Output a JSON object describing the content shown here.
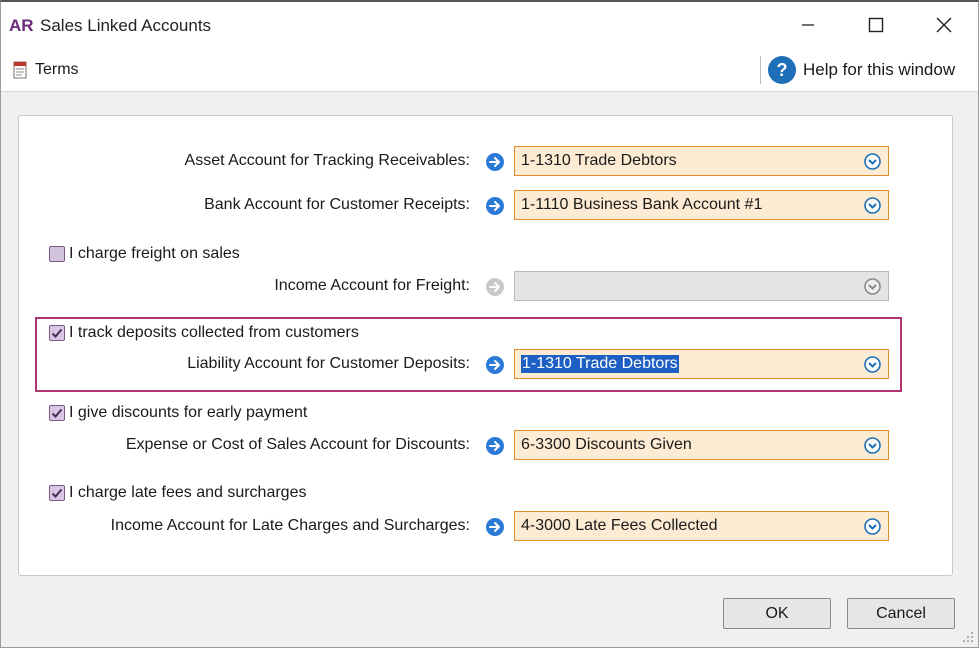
{
  "window": {
    "app_badge": "AR",
    "title": "Sales Linked Accounts"
  },
  "toolbar": {
    "terms_label": "Terms",
    "help_label": "Help for this window"
  },
  "rows": {
    "asset": {
      "label": "Asset Account for Tracking Receivables:",
      "value": "1-1310 Trade Debtors"
    },
    "bank": {
      "label": "Bank Account for Customer Receipts:",
      "value": "1-1110 Business Bank Account #1"
    },
    "freight": {
      "checkbox_label": "I charge freight on sales",
      "checked": false,
      "label": "Income Account for Freight:",
      "value": ""
    },
    "deposits": {
      "checkbox_label": "I track deposits collected from customers",
      "checked": true,
      "label": "Liability Account for Customer Deposits:",
      "value": "1-1310 Trade Debtors"
    },
    "discounts": {
      "checkbox_label": "I give discounts for early payment",
      "checked": true,
      "label": "Expense or Cost of Sales Account for Discounts:",
      "value": "6-3300 Discounts Given"
    },
    "late_fees": {
      "checkbox_label": "I charge late fees and surcharges",
      "checked": true,
      "label": "Income Account for Late Charges and Surcharges:",
      "value": "4-3000 Late Fees Collected"
    }
  },
  "buttons": {
    "ok": "OK",
    "cancel": "Cancel"
  },
  "colors": {
    "accent": "#6a2a7a",
    "field_bg": "#fdebd3",
    "field_border": "#e38a2b",
    "highlight_border": "#b0346f",
    "selection": "#1e5fc4",
    "arrow_blue": "#2b7bd6"
  }
}
